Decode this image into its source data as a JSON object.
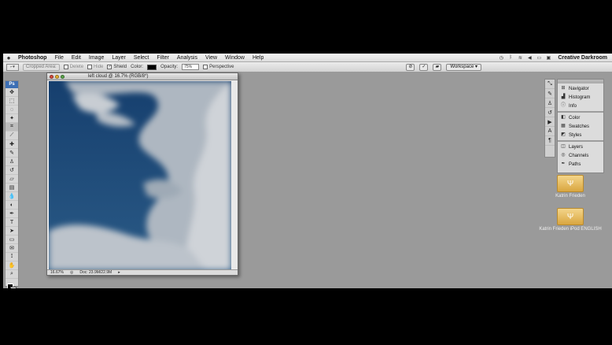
{
  "menubar": {
    "app_name": "Photoshop",
    "items": [
      "File",
      "Edit",
      "Image",
      "Layer",
      "Select",
      "Filter",
      "Analysis",
      "View",
      "Window",
      "Help"
    ],
    "right_title": "Creative Darkroom"
  },
  "options_bar": {
    "cropped_area": "Cropped Area:",
    "delete": "Delete",
    "hide": "Hide",
    "shield": "Shield",
    "color_label": "Color:",
    "opacity_label": "Opacity:",
    "opacity_value": "75%",
    "perspective": "Perspective",
    "workspace": "Workspace"
  },
  "document": {
    "title": "left cloud @ 16.7% (RGB/8*)",
    "zoom": "16.67%",
    "doc_size": "Doc: 23.9M/22.9M"
  },
  "panels": {
    "group1": [
      "Navigator",
      "Histogram",
      "Info"
    ],
    "group2": [
      "Color",
      "Swatches",
      "Styles"
    ],
    "group3": [
      "Layers",
      "Channels",
      "Paths"
    ]
  },
  "desktop": {
    "item1": "Katrin Frieden",
    "item2": "Katrin Frieden iPod ENGLISH"
  },
  "colors": {
    "sky_blue": "#1c4a78",
    "cloud_white": "#c9ccd0",
    "desktop_gray": "#9a9a9a",
    "disk_yellow": "#e8c060"
  }
}
